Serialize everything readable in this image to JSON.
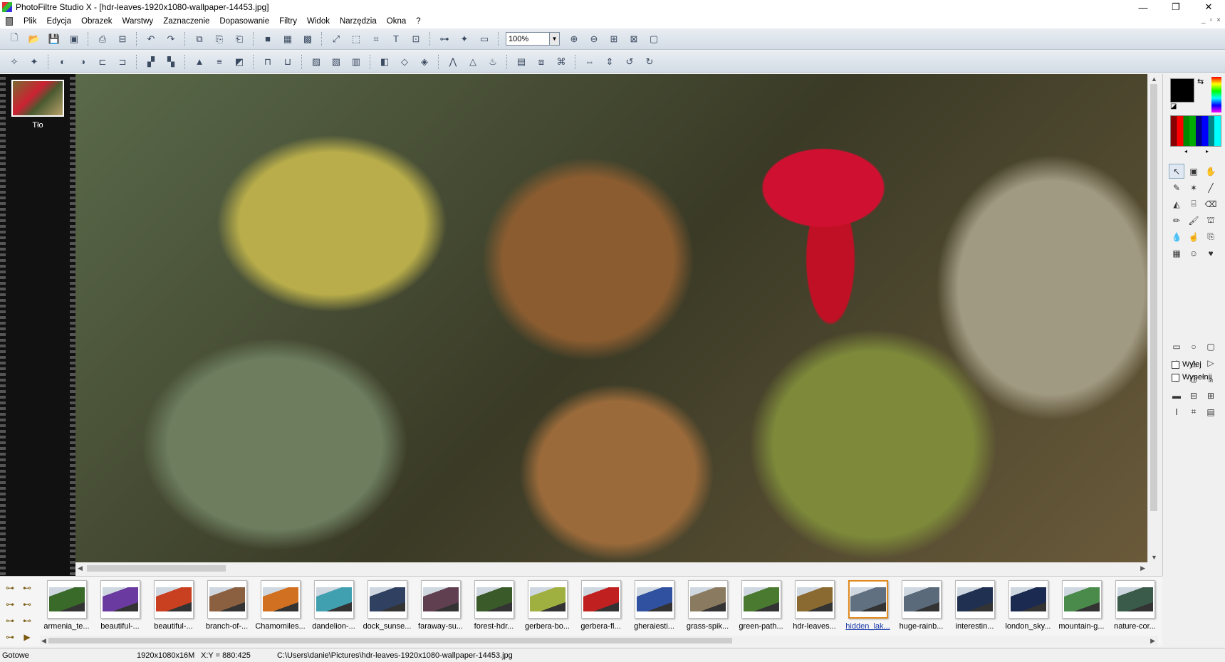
{
  "window": {
    "title": "PhotoFiltre Studio X - [hdr-leaves-1920x1080-wallpaper-14453.jpg]",
    "controls": [
      "—",
      "❐",
      "✕"
    ]
  },
  "menu": [
    "Plik",
    "Edycja",
    "Obrazek",
    "Warstwy",
    "Zaznaczenie",
    "Dopasowanie",
    "Filtry",
    "Widok",
    "Narzędzia",
    "Okna",
    "?"
  ],
  "toolbar": {
    "zoom": "100%"
  },
  "layers": {
    "items": [
      {
        "name": "Tło"
      }
    ]
  },
  "tool_options": {
    "outline_label": "Wyłej",
    "fill_label": "Wypełnij"
  },
  "browser": {
    "files": [
      {
        "label": "armenia_te...",
        "color": "#3a6a2a"
      },
      {
        "label": "beautiful-...",
        "color": "#6a3aa0"
      },
      {
        "label": "beautiful-...",
        "color": "#c84020"
      },
      {
        "label": "branch-of-...",
        "color": "#8a6040"
      },
      {
        "label": "Chamomiles...",
        "color": "#d07020"
      },
      {
        "label": "dandelion-...",
        "color": "#40a0b0"
      },
      {
        "label": "dock_sunse...",
        "color": "#304060"
      },
      {
        "label": "faraway-su...",
        "color": "#604050"
      },
      {
        "label": "forest-hdr...",
        "color": "#3a5a2a"
      },
      {
        "label": "gerbera-bo...",
        "color": "#a0b040"
      },
      {
        "label": "gerbera-fl...",
        "color": "#c02020"
      },
      {
        "label": "gheraiesti...",
        "color": "#3050a0"
      },
      {
        "label": "grass-spik...",
        "color": "#8a7a60"
      },
      {
        "label": "green-path...",
        "color": "#4a7a30"
      },
      {
        "label": "hdr-leaves...",
        "color": "#8a6a30"
      },
      {
        "label": "hidden_lak...",
        "color": "#607080"
      },
      {
        "label": "huge-rainb...",
        "color": "#5a6a7a"
      },
      {
        "label": "interestin...",
        "color": "#203050"
      },
      {
        "label": "london_sky...",
        "color": "#1a2a50"
      },
      {
        "label": "mountain-g...",
        "color": "#4a8a4a"
      },
      {
        "label": "nature-cor...",
        "color": "#3a5a4a"
      }
    ],
    "selected_index": 15
  },
  "status": {
    "state": "Gotowe",
    "image_info": "1920x1080x16M",
    "coords": "X:Y = 880:425",
    "path": "C:\\Users\\danie\\Pictures\\hdr-leaves-1920x1080-wallpaper-14453.jpg"
  }
}
